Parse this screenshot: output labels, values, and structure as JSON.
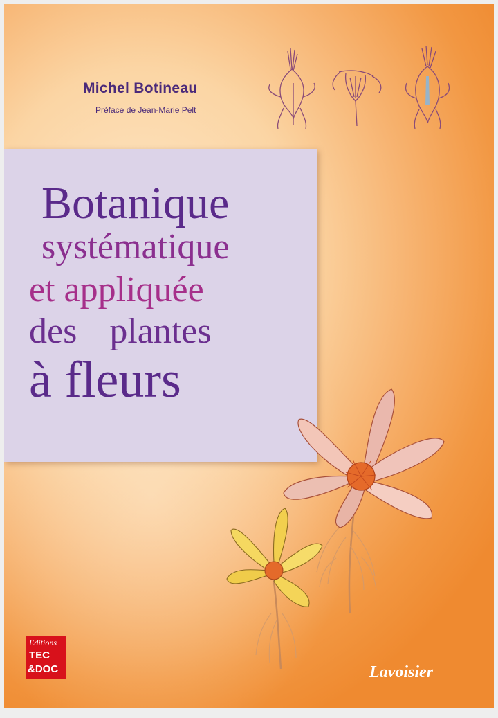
{
  "cover": {
    "author": "Michel Botineau",
    "preface": "Préface de Jean-Marie Pelt",
    "title_lines": [
      "Botanique",
      "systématique",
      "et appliquée",
      "des plantes",
      "à fleurs"
    ],
    "publisher_logo": {
      "line1": "Editions",
      "line2": "TEC",
      "line3": "&DOC"
    },
    "publisher": "Lavoisier"
  },
  "colors": {
    "background_orange": "#ef8a30",
    "title_box": "#dcd3e8",
    "title_purple": "#5a2a8a",
    "title_magenta": "#a62f8a",
    "logo_red": "#d8111b"
  },
  "illustrations": {
    "top": "flower-dissection-drawings",
    "main": "pasque-flower-illustrations"
  }
}
